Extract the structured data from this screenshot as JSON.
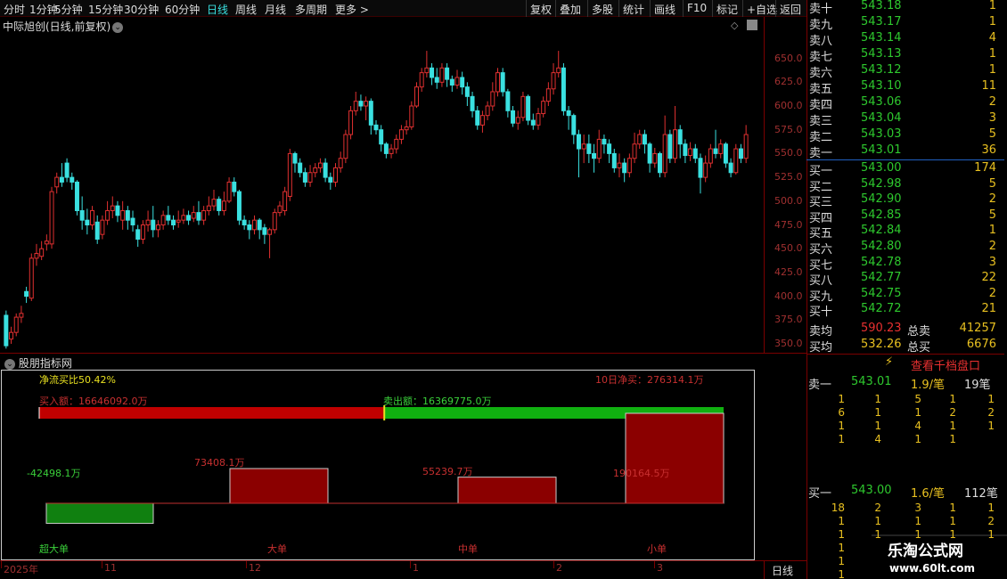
{
  "toolbar": {
    "left_items": [
      "分时",
      "1分钟",
      "5分钟",
      "15分钟",
      "30分钟",
      "60分钟",
      "日线",
      "周线",
      "月线",
      "多周期",
      "更多 >"
    ],
    "active_index": 6,
    "right_items": [
      "复权",
      "叠加",
      "多股",
      "统计",
      "画线",
      "F10",
      "标记",
      "+自选",
      "返回"
    ]
  },
  "stock_title": "中际旭创(日线,前复权)",
  "price_axis": [
    "650.0",
    "625.0",
    "600.0",
    "575.0",
    "550.0",
    "525.0",
    "500.0",
    "475.0",
    "450.0",
    "425.0",
    "400.0",
    "375.0",
    "350.0"
  ],
  "indicator": {
    "title": "股朋指标网",
    "net_ratio": "净流买比50.42%",
    "net_10d": "10日净买：276314.1万",
    "buy_amount": "买入额：16646092.0万",
    "sell_amount": "卖出额：16369775.0万",
    "buy_fraction": 0.5042,
    "bars": [
      {
        "label": "超大单",
        "value": "-42498.1万",
        "num": -42498.1
      },
      {
        "label": "大单",
        "value": "73408.1万",
        "num": 73408.1
      },
      {
        "label": "中单",
        "value": "55239.7万",
        "num": 55239.7
      },
      {
        "label": "小单",
        "value": "190164.5万",
        "num": 190164.5
      }
    ]
  },
  "date_axis": [
    "2025年",
    "11",
    "12",
    "1",
    "2",
    "3"
  ],
  "period": "日线",
  "asks": [
    {
      "label": "卖十",
      "price": "543.18",
      "vol": "1"
    },
    {
      "label": "卖九",
      "price": "543.17",
      "vol": "1"
    },
    {
      "label": "卖八",
      "price": "543.14",
      "vol": "4"
    },
    {
      "label": "卖七",
      "price": "543.13",
      "vol": "1"
    },
    {
      "label": "卖六",
      "price": "543.12",
      "vol": "1"
    },
    {
      "label": "卖五",
      "price": "543.10",
      "vol": "11"
    },
    {
      "label": "卖四",
      "price": "543.06",
      "vol": "2"
    },
    {
      "label": "卖三",
      "price": "543.04",
      "vol": "3"
    },
    {
      "label": "卖二",
      "price": "543.03",
      "vol": "5"
    },
    {
      "label": "卖一",
      "price": "543.01",
      "vol": "36"
    }
  ],
  "bids": [
    {
      "label": "买一",
      "price": "543.00",
      "vol": "174"
    },
    {
      "label": "买二",
      "price": "542.98",
      "vol": "5"
    },
    {
      "label": "买三",
      "price": "542.90",
      "vol": "2"
    },
    {
      "label": "买四",
      "price": "542.85",
      "vol": "5"
    },
    {
      "label": "买五",
      "price": "542.84",
      "vol": "1"
    },
    {
      "label": "买六",
      "price": "542.80",
      "vol": "2"
    },
    {
      "label": "买七",
      "price": "542.78",
      "vol": "3"
    },
    {
      "label": "买八",
      "price": "542.77",
      "vol": "22"
    },
    {
      "label": "买九",
      "price": "542.75",
      "vol": "2"
    },
    {
      "label": "买十",
      "price": "542.72",
      "vol": "21"
    }
  ],
  "summary": {
    "sell_avg_label": "卖均",
    "sell_avg": "590.23",
    "sell_total_label": "总卖",
    "sell_total": "41257",
    "buy_avg_label": "买均",
    "buy_avg": "532.26",
    "buy_total_label": "总买",
    "buy_total": "6676"
  },
  "queue": {
    "button": "查看千档盘口",
    "ask_head": {
      "label": "卖一",
      "price": "543.01",
      "avg": "1.9/笔",
      "count": "19笔"
    },
    "ask_rows": [
      [
        "1",
        "1",
        "5",
        "1",
        "1"
      ],
      [
        "6",
        "1",
        "1",
        "2",
        "2"
      ],
      [
        "1",
        "1",
        "4",
        "1",
        "1"
      ],
      [
        "1",
        "4",
        "1",
        "1",
        ""
      ]
    ],
    "bid_head": {
      "label": "买一",
      "price": "543.00",
      "avg": "1.6/笔",
      "count": "112笔"
    },
    "bid_rows": [
      [
        "18",
        "2",
        "3",
        "1",
        "1"
      ],
      [
        "1",
        "1",
        "1",
        "1",
        "2"
      ],
      [
        "1",
        "1",
        "1",
        "1",
        "1"
      ],
      [
        "1",
        "",
        "",
        "",
        ""
      ],
      [
        "1",
        "",
        "",
        "",
        ""
      ],
      [
        "1",
        "",
        "",
        "",
        ""
      ]
    ]
  },
  "watermark": {
    "name": "乐淘公式网",
    "url": "www.60lt.com"
  },
  "colors": {
    "up": "#e03030",
    "down": "#3ae0e0",
    "buy_bar": "#c00000",
    "sell_bar": "#10b010",
    "bid_price": "#2ec82e",
    "vol": "#e8c020"
  },
  "chart_data": {
    "type": "candlestick",
    "ylim": [
      350,
      660
    ],
    "candles": [
      {
        "o": 380,
        "c": 348,
        "h": 385,
        "l": 345
      },
      {
        "o": 355,
        "c": 362,
        "h": 368,
        "l": 350
      },
      {
        "o": 362,
        "c": 378,
        "h": 382,
        "l": 358
      },
      {
        "o": 378,
        "c": 382,
        "h": 390,
        "l": 372
      },
      {
        "o": 405,
        "c": 400,
        "h": 410,
        "l": 393
      },
      {
        "o": 398,
        "c": 440,
        "h": 445,
        "l": 395
      },
      {
        "o": 440,
        "c": 445,
        "h": 455,
        "l": 432
      },
      {
        "o": 442,
        "c": 450,
        "h": 458,
        "l": 438
      },
      {
        "o": 455,
        "c": 458,
        "h": 465,
        "l": 448
      },
      {
        "o": 455,
        "c": 510,
        "h": 515,
        "l": 450
      },
      {
        "o": 515,
        "c": 525,
        "h": 530,
        "l": 508
      },
      {
        "o": 525,
        "c": 520,
        "h": 540,
        "l": 515
      },
      {
        "o": 540,
        "c": 525,
        "h": 545,
        "l": 520
      },
      {
        "o": 525,
        "c": 520,
        "h": 530,
        "l": 512
      },
      {
        "o": 520,
        "c": 490,
        "h": 522,
        "l": 485
      },
      {
        "o": 490,
        "c": 480,
        "h": 505,
        "l": 470
      },
      {
        "o": 480,
        "c": 475,
        "h": 492,
        "l": 465
      },
      {
        "o": 475,
        "c": 490,
        "h": 495,
        "l": 470
      },
      {
        "o": 478,
        "c": 460,
        "h": 485,
        "l": 455
      },
      {
        "o": 465,
        "c": 480,
        "h": 485,
        "l": 460
      },
      {
        "o": 480,
        "c": 490,
        "h": 500,
        "l": 475
      },
      {
        "o": 490,
        "c": 495,
        "h": 505,
        "l": 482
      },
      {
        "o": 495,
        "c": 485,
        "h": 500,
        "l": 478
      },
      {
        "o": 480,
        "c": 490,
        "h": 500,
        "l": 470
      },
      {
        "o": 490,
        "c": 480,
        "h": 495,
        "l": 470
      },
      {
        "o": 482,
        "c": 475,
        "h": 490,
        "l": 468
      },
      {
        "o": 470,
        "c": 460,
        "h": 475,
        "l": 452
      },
      {
        "o": 460,
        "c": 475,
        "h": 480,
        "l": 455
      },
      {
        "o": 475,
        "c": 480,
        "h": 490,
        "l": 468
      },
      {
        "o": 480,
        "c": 470,
        "h": 495,
        "l": 462
      },
      {
        "o": 470,
        "c": 475,
        "h": 480,
        "l": 462
      },
      {
        "o": 475,
        "c": 485,
        "h": 490,
        "l": 470
      },
      {
        "o": 485,
        "c": 480,
        "h": 495,
        "l": 475
      },
      {
        "o": 480,
        "c": 475,
        "h": 485,
        "l": 470
      },
      {
        "o": 478,
        "c": 480,
        "h": 490,
        "l": 472
      },
      {
        "o": 480,
        "c": 485,
        "h": 492,
        "l": 476
      },
      {
        "o": 485,
        "c": 480,
        "h": 490,
        "l": 475
      },
      {
        "o": 482,
        "c": 488,
        "h": 495,
        "l": 478
      },
      {
        "o": 488,
        "c": 480,
        "h": 500,
        "l": 475
      },
      {
        "o": 480,
        "c": 490,
        "h": 495,
        "l": 475
      },
      {
        "o": 490,
        "c": 495,
        "h": 505,
        "l": 485
      },
      {
        "o": 495,
        "c": 502,
        "h": 512,
        "l": 490
      },
      {
        "o": 502,
        "c": 490,
        "h": 505,
        "l": 485
      },
      {
        "o": 490,
        "c": 500,
        "h": 510,
        "l": 485
      },
      {
        "o": 500,
        "c": 520,
        "h": 525,
        "l": 498
      },
      {
        "o": 520,
        "c": 510,
        "h": 525,
        "l": 505
      },
      {
        "o": 510,
        "c": 480,
        "h": 512,
        "l": 475
      },
      {
        "o": 480,
        "c": 475,
        "h": 485,
        "l": 470
      },
      {
        "o": 475,
        "c": 470,
        "h": 480,
        "l": 460
      },
      {
        "o": 470,
        "c": 480,
        "h": 485,
        "l": 465
      },
      {
        "o": 480,
        "c": 470,
        "h": 482,
        "l": 460
      },
      {
        "o": 472,
        "c": 465,
        "h": 476,
        "l": 455
      },
      {
        "o": 465,
        "c": 470,
        "h": 472,
        "l": 440
      },
      {
        "o": 470,
        "c": 488,
        "h": 492,
        "l": 466
      },
      {
        "o": 488,
        "c": 495,
        "h": 500,
        "l": 484
      },
      {
        "o": 490,
        "c": 510,
        "h": 515,
        "l": 485
      },
      {
        "o": 505,
        "c": 550,
        "h": 555,
        "l": 500
      },
      {
        "o": 550,
        "c": 540,
        "h": 552,
        "l": 530
      },
      {
        "o": 540,
        "c": 530,
        "h": 545,
        "l": 525
      },
      {
        "o": 530,
        "c": 520,
        "h": 535,
        "l": 515
      },
      {
        "o": 520,
        "c": 530,
        "h": 538,
        "l": 515
      },
      {
        "o": 530,
        "c": 535,
        "h": 540,
        "l": 525
      },
      {
        "o": 535,
        "c": 540,
        "h": 545,
        "l": 530
      },
      {
        "o": 540,
        "c": 525,
        "h": 545,
        "l": 520
      },
      {
        "o": 525,
        "c": 520,
        "h": 530,
        "l": 512
      },
      {
        "o": 520,
        "c": 535,
        "h": 540,
        "l": 515
      },
      {
        "o": 535,
        "c": 545,
        "h": 552,
        "l": 530
      },
      {
        "o": 545,
        "c": 570,
        "h": 575,
        "l": 540
      },
      {
        "o": 570,
        "c": 595,
        "h": 600,
        "l": 565
      },
      {
        "o": 595,
        "c": 605,
        "h": 615,
        "l": 590
      },
      {
        "o": 605,
        "c": 600,
        "h": 612,
        "l": 595
      },
      {
        "o": 600,
        "c": 605,
        "h": 610,
        "l": 585
      },
      {
        "o": 605,
        "c": 580,
        "h": 608,
        "l": 570
      },
      {
        "o": 580,
        "c": 575,
        "h": 585,
        "l": 570
      },
      {
        "o": 575,
        "c": 560,
        "h": 580,
        "l": 552
      },
      {
        "o": 560,
        "c": 550,
        "h": 562,
        "l": 545
      },
      {
        "o": 550,
        "c": 555,
        "h": 560,
        "l": 545
      },
      {
        "o": 555,
        "c": 565,
        "h": 570,
        "l": 550
      },
      {
        "o": 565,
        "c": 575,
        "h": 580,
        "l": 560
      },
      {
        "o": 575,
        "c": 578,
        "h": 585,
        "l": 570
      },
      {
        "o": 578,
        "c": 600,
        "h": 605,
        "l": 575
      },
      {
        "o": 600,
        "c": 620,
        "h": 625,
        "l": 598
      },
      {
        "o": 620,
        "c": 635,
        "h": 640,
        "l": 615
      },
      {
        "o": 635,
        "c": 640,
        "h": 658,
        "l": 630
      },
      {
        "o": 640,
        "c": 630,
        "h": 645,
        "l": 622
      },
      {
        "o": 630,
        "c": 625,
        "h": 640,
        "l": 618
      },
      {
        "o": 625,
        "c": 640,
        "h": 645,
        "l": 620
      },
      {
        "o": 640,
        "c": 628,
        "h": 645,
        "l": 620
      },
      {
        "o": 628,
        "c": 622,
        "h": 632,
        "l": 615
      },
      {
        "o": 622,
        "c": 630,
        "h": 638,
        "l": 618
      },
      {
        "o": 630,
        "c": 620,
        "h": 636,
        "l": 612
      },
      {
        "o": 620,
        "c": 610,
        "h": 625,
        "l": 600
      },
      {
        "o": 610,
        "c": 595,
        "h": 615,
        "l": 588
      },
      {
        "o": 595,
        "c": 580,
        "h": 600,
        "l": 575
      },
      {
        "o": 580,
        "c": 590,
        "h": 595,
        "l": 572
      },
      {
        "o": 590,
        "c": 600,
        "h": 605,
        "l": 585
      },
      {
        "o": 600,
        "c": 615,
        "h": 625,
        "l": 595
      },
      {
        "o": 615,
        "c": 635,
        "h": 640,
        "l": 610
      },
      {
        "o": 635,
        "c": 615,
        "h": 640,
        "l": 610
      },
      {
        "o": 615,
        "c": 595,
        "h": 618,
        "l": 588
      },
      {
        "o": 595,
        "c": 582,
        "h": 600,
        "l": 578
      },
      {
        "o": 582,
        "c": 588,
        "h": 595,
        "l": 575
      },
      {
        "o": 588,
        "c": 610,
        "h": 615,
        "l": 584
      },
      {
        "o": 610,
        "c": 585,
        "h": 612,
        "l": 580
      },
      {
        "o": 585,
        "c": 580,
        "h": 592,
        "l": 575
      },
      {
        "o": 580,
        "c": 592,
        "h": 598,
        "l": 575
      },
      {
        "o": 592,
        "c": 605,
        "h": 610,
        "l": 588
      },
      {
        "o": 605,
        "c": 618,
        "h": 625,
        "l": 600
      },
      {
        "o": 618,
        "c": 635,
        "h": 645,
        "l": 612
      },
      {
        "o": 635,
        "c": 640,
        "h": 658,
        "l": 630
      },
      {
        "o": 640,
        "c": 595,
        "h": 645,
        "l": 590
      },
      {
        "o": 595,
        "c": 590,
        "h": 600,
        "l": 575
      },
      {
        "o": 590,
        "c": 570,
        "h": 592,
        "l": 560
      },
      {
        "o": 570,
        "c": 555,
        "h": 575,
        "l": 525
      },
      {
        "o": 555,
        "c": 560,
        "h": 570,
        "l": 540
      },
      {
        "o": 560,
        "c": 550,
        "h": 570,
        "l": 540
      },
      {
        "o": 550,
        "c": 545,
        "h": 560,
        "l": 530
      },
      {
        "o": 545,
        "c": 565,
        "h": 575,
        "l": 540
      },
      {
        "o": 565,
        "c": 560,
        "h": 570,
        "l": 550
      },
      {
        "o": 560,
        "c": 550,
        "h": 565,
        "l": 540
      },
      {
        "o": 550,
        "c": 535,
        "h": 555,
        "l": 530
      },
      {
        "o": 535,
        "c": 540,
        "h": 550,
        "l": 525
      },
      {
        "o": 540,
        "c": 530,
        "h": 545,
        "l": 520
      },
      {
        "o": 530,
        "c": 545,
        "h": 550,
        "l": 525
      },
      {
        "o": 545,
        "c": 560,
        "h": 572,
        "l": 540
      },
      {
        "o": 560,
        "c": 570,
        "h": 575,
        "l": 555
      },
      {
        "o": 570,
        "c": 560,
        "h": 575,
        "l": 550
      },
      {
        "o": 560,
        "c": 540,
        "h": 562,
        "l": 530
      },
      {
        "o": 540,
        "c": 550,
        "h": 556,
        "l": 535
      },
      {
        "o": 550,
        "c": 530,
        "h": 552,
        "l": 525
      },
      {
        "o": 530,
        "c": 570,
        "h": 590,
        "l": 525
      },
      {
        "o": 570,
        "c": 545,
        "h": 575,
        "l": 540
      },
      {
        "o": 545,
        "c": 575,
        "h": 600,
        "l": 540
      },
      {
        "o": 575,
        "c": 560,
        "h": 580,
        "l": 545
      },
      {
        "o": 560,
        "c": 548,
        "h": 565,
        "l": 540
      },
      {
        "o": 548,
        "c": 555,
        "h": 562,
        "l": 542
      },
      {
        "o": 555,
        "c": 545,
        "h": 560,
        "l": 540
      },
      {
        "o": 545,
        "c": 525,
        "h": 550,
        "l": 508
      },
      {
        "o": 525,
        "c": 540,
        "h": 548,
        "l": 520
      },
      {
        "o": 540,
        "c": 555,
        "h": 560,
        "l": 535
      },
      {
        "o": 555,
        "c": 550,
        "h": 575,
        "l": 545
      },
      {
        "o": 550,
        "c": 560,
        "h": 565,
        "l": 545
      },
      {
        "o": 560,
        "c": 540,
        "h": 562,
        "l": 535
      },
      {
        "o": 540,
        "c": 530,
        "h": 545,
        "l": 525
      },
      {
        "o": 530,
        "c": 555,
        "h": 560,
        "l": 528
      },
      {
        "o": 555,
        "c": 545,
        "h": 560,
        "l": 540
      },
      {
        "o": 545,
        "c": 570,
        "h": 580,
        "l": 540
      }
    ]
  }
}
